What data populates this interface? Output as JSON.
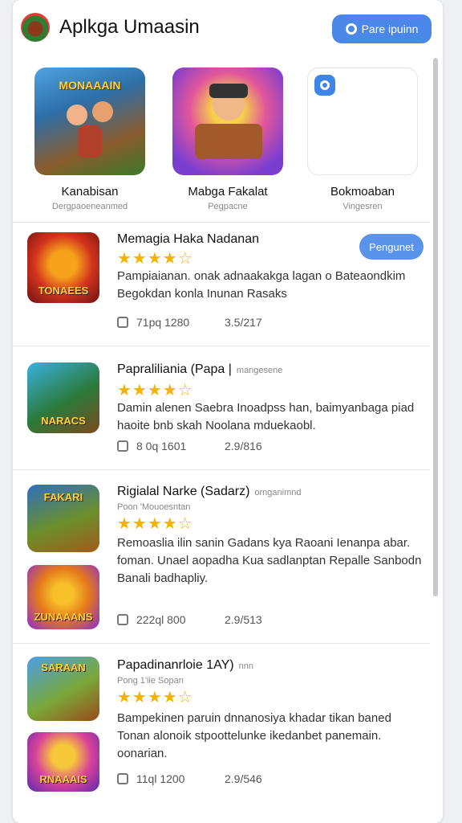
{
  "header": {
    "title": "Aplkga Umaasin",
    "button_label": "Pare ipuinn"
  },
  "featured": [
    {
      "name": "Kanabisan",
      "sub": "Dergpaoeneanmed",
      "art_label": "MONAAAIN"
    },
    {
      "name": "Mabga Fakalat",
      "sub": "Pegpacne",
      "art_label": ""
    },
    {
      "name": "Bokmoaban",
      "sub": "Vingesren",
      "art_label": ""
    }
  ],
  "rows": [
    {
      "title": "Memagia Haka Nadanan",
      "tag": "",
      "subline": "",
      "stars": "★★★★☆",
      "desc": "Pampiaianan. onak adnaakakga lagan o Bateaondkim Begokdan konla Inunan Rasaks",
      "meta1": "71pq 1280",
      "meta2": "3.5/217",
      "icon_label": "TONAEES",
      "button_label": "Pengunet"
    },
    {
      "title": "Papraliliania (Papa |",
      "tag": "mangesene",
      "subline": "",
      "stars": "★★★★☆",
      "desc": "Damin alenen Saebra Inoadpss han, baimyanbaga piad haoite bnb skah Noolana mduekaobl.",
      "meta1": "8 0q 1601",
      "meta2": "2.9/816",
      "icon_label": "NARACS",
      "button_label": ""
    },
    {
      "title": "Rigialal Narke (Sadarz)",
      "tag": "ornganimnd",
      "subline": "Poon 'Mouoesntan",
      "stars": "★★★★☆",
      "desc": "Remoaslia ilin sanin Gadans kya Raoani Ienanpa abar. foman. Unael aopadha Kua sadlanptan Repalle Sanbodn Banali badhapliy.",
      "meta1": "222ql 800",
      "meta2": "2.9/513",
      "icon_label": "FAKARI",
      "icon2_label": "ZUNAAANS",
      "button_label": ""
    },
    {
      "title": "Papadinanrloie 1AY)",
      "tag": "nnn",
      "subline": "Pong 1'iie Sopan",
      "stars": "★★★★☆",
      "desc": "Bampekinen paruin dnnanosiya khadar tikan baned Tonan alonoik stpoottelunke ikedanbet panemain. oonarian.",
      "meta1": "11ql 1200",
      "meta2": "2.9/546",
      "icon_label": "SARAAN",
      "icon2_label": "RNAAAIS",
      "button_label": ""
    }
  ]
}
